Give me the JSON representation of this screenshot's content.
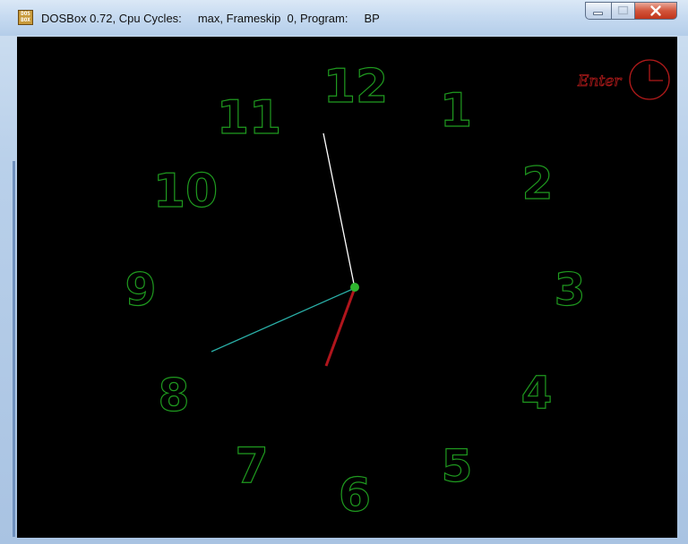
{
  "window": {
    "title": "DOSBox 0.72, Cpu Cycles:     max, Frameskip  0, Program:     BP",
    "app_icon_text": "DOS BOX",
    "controls": [
      "minimize",
      "maximize",
      "close"
    ]
  },
  "clock": {
    "numerals": [
      "12",
      "1",
      "2",
      "3",
      "4",
      "5",
      "6",
      "7",
      "8",
      "9",
      "10",
      "11"
    ],
    "numeral_color": "#1f9a1f",
    "hands": {
      "minute_color": "#ffffff",
      "second_color": "#2ab0a8",
      "hour_color": "#b0151c"
    },
    "hub_color": "#2fb52f"
  },
  "enter_button": {
    "label": "Enter",
    "color": "#b01a1a",
    "icon": "clock-icon"
  }
}
